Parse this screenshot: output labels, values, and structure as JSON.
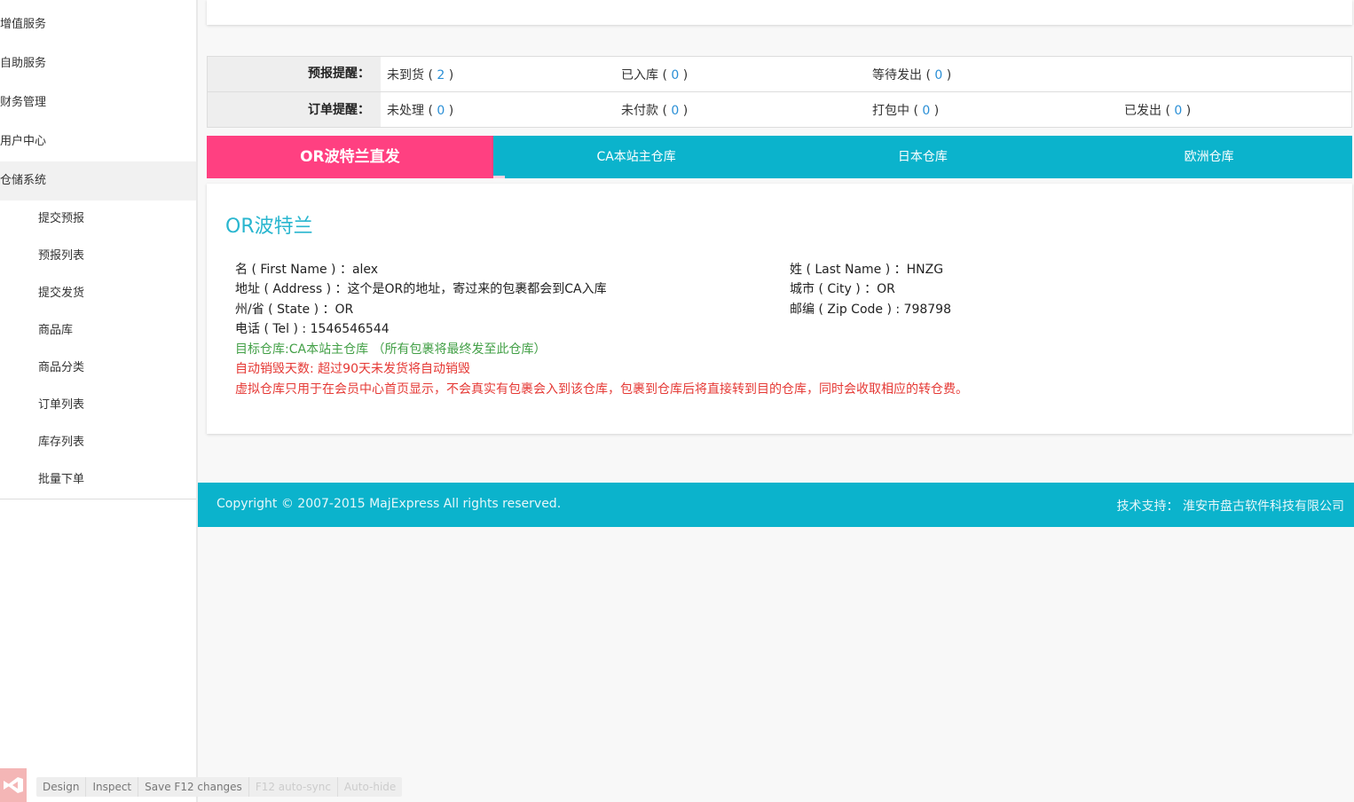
{
  "sidebar": {
    "top_items": [
      {
        "label": "增值服务"
      },
      {
        "label": "自助服务"
      },
      {
        "label": "财务管理"
      },
      {
        "label": "用户中心"
      },
      {
        "label": "仓储系统"
      }
    ],
    "sub_items": [
      {
        "label": "提交预报"
      },
      {
        "label": "预报列表"
      },
      {
        "label": "提交发货"
      },
      {
        "label": "商品库"
      },
      {
        "label": "商品分类"
      },
      {
        "label": "订单列表"
      },
      {
        "label": "库存列表"
      },
      {
        "label": "批量下单"
      }
    ]
  },
  "reminders": {
    "forecast": {
      "label": "预报提醒：",
      "items": [
        {
          "label": "未到货 (",
          "count": "2",
          "close": ")"
        },
        {
          "label": "已入库 (",
          "count": "0",
          "close": ")"
        },
        {
          "label": "等待发出 (",
          "count": "0",
          "close": ")"
        }
      ]
    },
    "order": {
      "label": "订单提醒：",
      "items": [
        {
          "label": "未处理 (",
          "count": "0",
          "close": ")"
        },
        {
          "label": "未付款 ( ",
          "count": "0",
          "close": " )"
        },
        {
          "label": "打包中 ( ",
          "count": "0",
          "close": " )"
        },
        {
          "label": "已发出 (",
          "count": "0",
          "close": ")"
        }
      ]
    },
    "count_color": "#2a8fd6"
  },
  "tabs": [
    {
      "label": "OR波特兰直发",
      "active": true
    },
    {
      "label": "CA本站主仓库"
    },
    {
      "label": "日本仓库"
    },
    {
      "label": "欧洲仓库"
    }
  ],
  "warehouse": {
    "title": "OR波特兰",
    "first_name": "名 ( First Name ) ：alex",
    "last_name": "姓 ( Last Name ) ：HNZG",
    "address": "地址 ( Address ) ：这个是OR的地址，寄过来的包裹都会到CA入库",
    "city": "城市 ( City ) ：OR",
    "state": "州/省 ( State ) ：OR",
    "zip": "邮编 ( Zip Code ) : 798798",
    "tel": "电话 ( Tel ) : 1546546544",
    "target": "目标仓库:CA本站主仓库 （所有包裹将最终发至此仓库）",
    "auto_destroy": "自动销毁天数: 超过90天未发货将自动销毁",
    "notice": "虚拟仓库只用于在会员中心首页显示，不会真实有包裹会入到该仓库，包裹到仓库后将直接转到目的仓库，同时会收取相应的转仓费。"
  },
  "footer": {
    "copyright": "Copyright © 2007-2015 MajExpress All rights reserved.",
    "support": "技术支持： 淮安市盘古软件科技有限公司"
  },
  "devbar": {
    "items": [
      "Design",
      "Inspect",
      "Save F12 changes",
      "F12 auto-sync",
      "Auto-hide"
    ]
  },
  "colors": {
    "accent": "#0bb3cc",
    "active_tab": "#ff4081",
    "title": "#29b6cf"
  }
}
